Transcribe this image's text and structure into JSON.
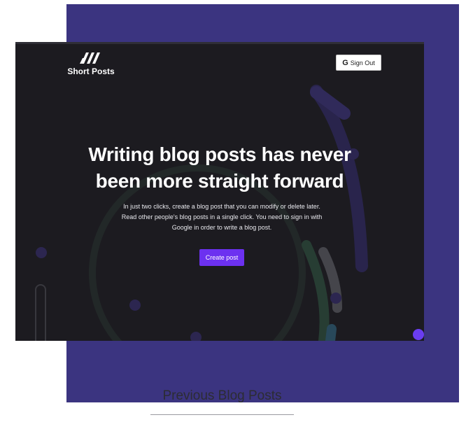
{
  "brand": {
    "name": "Short Posts",
    "logo_icon": "short-posts-logo-icon"
  },
  "header": {
    "signout_label": "Sign Out",
    "signout_icon": "google-g-icon"
  },
  "hero": {
    "headline_line1": "Writing blog posts has never",
    "headline_line2": "been more straight forward",
    "description": "In just two clicks, create a blog post that you can modify or delete later. Read other people's blog posts in a single click. You need to sign in with Google in order to write a blog post.",
    "cta_label": "Create post"
  },
  "previous_posts": {
    "title": "Previous Blog Posts"
  },
  "colors": {
    "backdrop": "#3b3480",
    "hero_background": "#1c1b20",
    "accent": "#6c31f0"
  }
}
